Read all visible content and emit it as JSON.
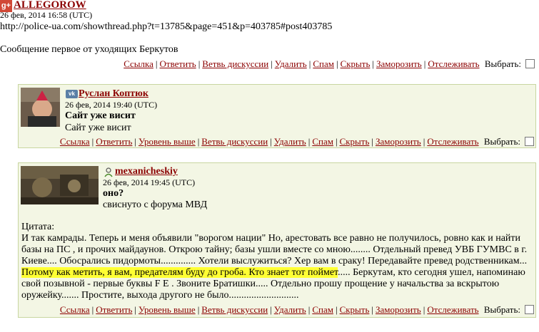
{
  "top_post": {
    "author": "ALLEGOROW",
    "date": "26 фев, 2014 16:58 (UTC)",
    "url": "http://police-ua.com/showthread.php?t=13785&page=451&p=403785#post403785",
    "text": "Сообщение первое от уходящих Беркутов",
    "actions": [
      "Ссылка",
      "Ответить",
      "Ветвь дискуссии",
      "Удалить",
      "Спам",
      "Скрыть",
      "Заморозить",
      "Отслеживать"
    ],
    "select_label": "Выбрать:"
  },
  "comment1": {
    "author": "Руслан Коптюк",
    "date": "26 фев, 2014 19:40 (UTC)",
    "title": "Сайт уже висит",
    "text": "Сайт уже висит",
    "actions": [
      "Ссылка",
      "Ответить",
      "Уровень выше",
      "Ветвь дискуссии",
      "Удалить",
      "Спам",
      "Скрыть",
      "Заморозить",
      "Отслеживать"
    ],
    "select_label": "Выбрать:"
  },
  "comment2": {
    "author": "mexanicheskiy",
    "date": "26 фев, 2014 19:45 (UTC)",
    "title": "оно?",
    "text": "свиснуто с форума МВД",
    "quote_label": "Цитата:",
    "quote_before": "И так камрады. Теперь и меня объявили \"ворогом нации\" Но, арестовать все равно не получилось, ровно как и найти базы на ПС , и прочих майдаунов. Открою тайну; базы ушли вместе со мною........ Отдельный превед УВБ ГУМВС в г. Киеве.... Обосрались пидормоты.............. Хотели выслужиться? Хер вам в сраку! Передавайте превед родственникам... ",
    "quote_highlight": "Потому как метить, я вам, предателям буду до гроба. Кто знает тот поймет",
    "quote_after": "..... Беркутам, кто сегодня ушел, напоминаю свой позывной - первые буквы F E . Звоните Братишки..... Отдельно прошу прощение у начальства за вскрытою оружейку....... Простите, выхода другого не было............................",
    "actions": [
      "Ссылка",
      "Ответить",
      "Уровень выше",
      "Ветвь дискуссии",
      "Удалить",
      "Спам",
      "Скрыть",
      "Заморозить",
      "Отслеживать"
    ],
    "select_label": "Выбрать:"
  },
  "colors": {
    "link": "#8b0000",
    "box_bg": "#f3f6e4",
    "box_border": "#c8d6a0",
    "highlight": "#ffff33"
  },
  "icons": {
    "top_post": "google-plus-icon",
    "comment1": "vk-icon",
    "comment2": "user-icon"
  }
}
